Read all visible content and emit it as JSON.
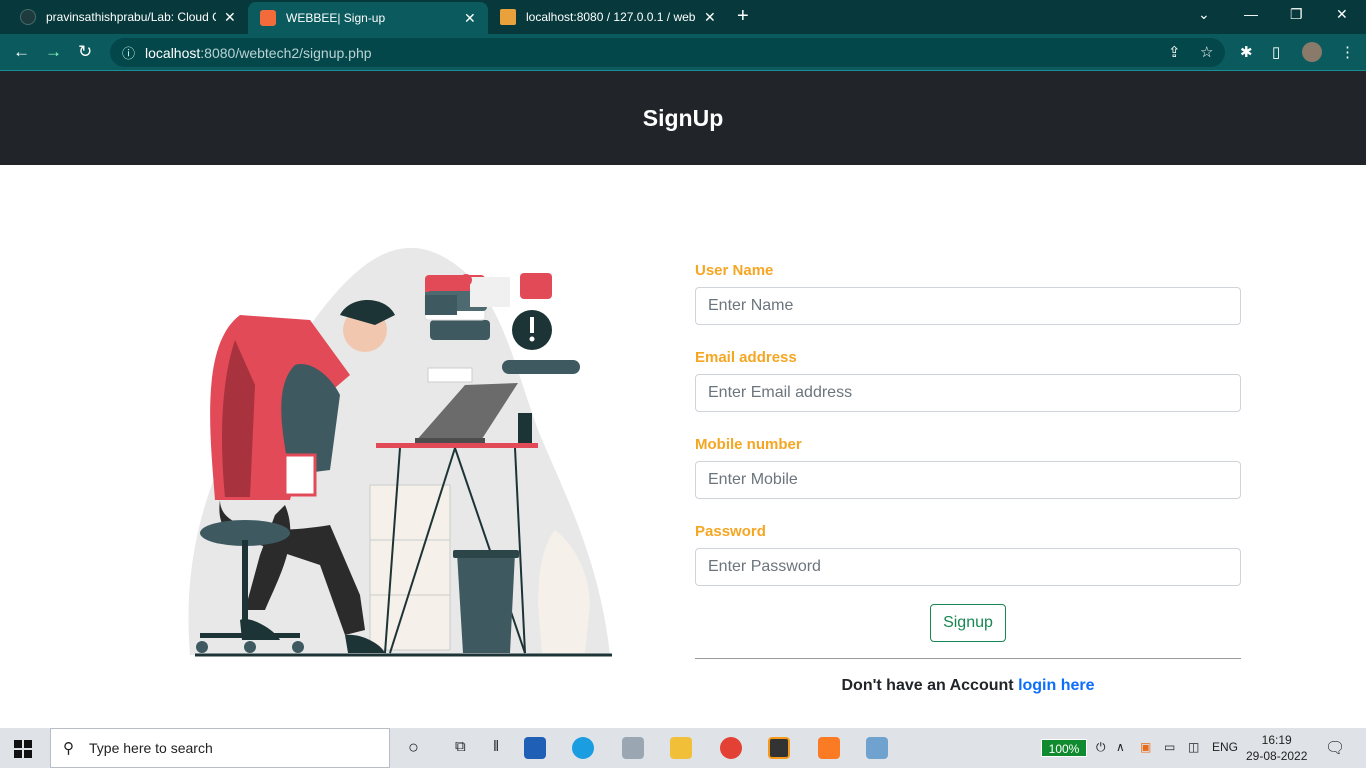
{
  "browser": {
    "tabs": [
      {
        "title": "pravinsathishprabu/Lab: Cloud C",
        "close": "✕"
      },
      {
        "title": "WEBBEE| Sign-up",
        "close": "✕"
      },
      {
        "title": "localhost:8080 / 127.0.0.1 / webp",
        "close": "✕"
      }
    ],
    "new_tab": "+",
    "url_host": "localhost",
    "url_path": ":8080/webtech2/signup.php"
  },
  "page": {
    "heading": "SignUp",
    "form": {
      "username_label": "User Name",
      "username_placeholder": "Enter Name",
      "email_label": "Email address",
      "email_placeholder": "Enter Email address",
      "mobile_label": "Mobile number",
      "mobile_placeholder": "Enter Mobile",
      "password_label": "Password",
      "password_placeholder": "Enter Password",
      "submit_label": "Signup"
    },
    "footer_text": "Don't have an Account",
    "footer_link": "login here"
  },
  "taskbar": {
    "search_placeholder": "Type here to search",
    "battery": "100%",
    "language": "ENG",
    "time": "16:19",
    "date": "29-08-2022"
  },
  "colors": {
    "label": "#f5a623",
    "button": "#198754",
    "link": "#0d6efd",
    "header": "#212529"
  }
}
